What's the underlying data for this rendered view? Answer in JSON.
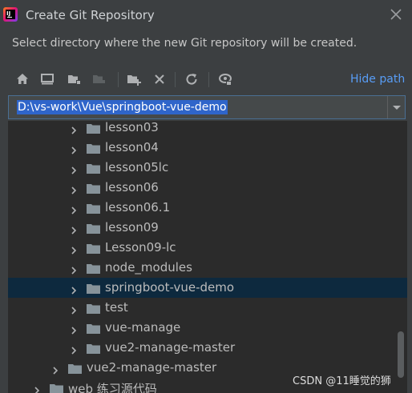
{
  "window": {
    "title": "Create Git Repository",
    "description": "Select directory where the new Git repository will be created."
  },
  "toolbar": {
    "icons": [
      "home-icon",
      "desktop-icon",
      "new-folder-icon",
      "collapse-icon",
      "new-folder-add-icon",
      "delete-icon",
      "refresh-icon",
      "show-hidden-icon"
    ],
    "hide_path_label": "Hide path"
  },
  "path": {
    "value": "D:\\vs-work\\Vue\\springboot-vue-demo"
  },
  "tree": {
    "items": [
      {
        "label": "lesson03",
        "depth": 3,
        "selected": false
      },
      {
        "label": "lesson04",
        "depth": 3,
        "selected": false
      },
      {
        "label": "lesson05lc",
        "depth": 3,
        "selected": false
      },
      {
        "label": "lesson06",
        "depth": 3,
        "selected": false
      },
      {
        "label": "lesson06.1",
        "depth": 3,
        "selected": false
      },
      {
        "label": "lesson09",
        "depth": 3,
        "selected": false
      },
      {
        "label": "Lesson09-lc",
        "depth": 3,
        "selected": false
      },
      {
        "label": "node_modules",
        "depth": 3,
        "selected": false
      },
      {
        "label": "springboot-vue-demo",
        "depth": 3,
        "selected": true
      },
      {
        "label": "test",
        "depth": 3,
        "selected": false
      },
      {
        "label": "vue-manage",
        "depth": 3,
        "selected": false
      },
      {
        "label": "vue2-manage-master",
        "depth": 3,
        "selected": false
      },
      {
        "label": "vue2-manage-master",
        "depth": 2,
        "selected": false
      },
      {
        "label": "web 练习源代码",
        "depth": 1,
        "selected": false
      }
    ]
  },
  "watermark": "CSDN @11睡觉的狮",
  "colors": {
    "background": "#3c3f41",
    "tree_background": "#2b2b2b",
    "selection": "#0d293e",
    "link": "#589df6",
    "path_highlight": "#2f65ca"
  }
}
